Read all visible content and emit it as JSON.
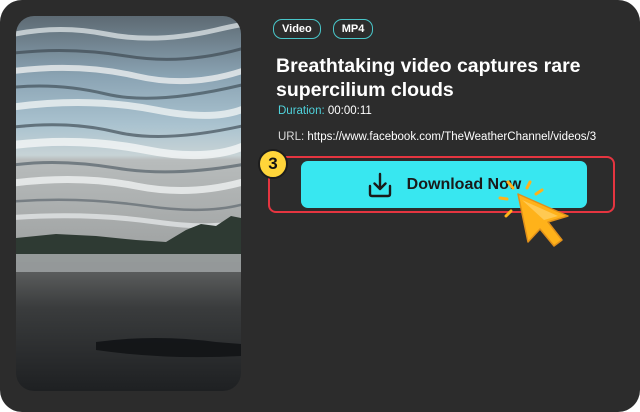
{
  "tags": [
    "Video",
    "MP4"
  ],
  "video": {
    "title": "Breathtaking video captures rare supercilium clouds",
    "duration_label": "Duration:",
    "duration_value": "00:00:11",
    "url_label": "URL:",
    "url_value": "https://www.facebook.com/TheWeatherChannel/videos/3"
  },
  "step_number": "3",
  "download_button": {
    "label": "Download Now",
    "icon": "download-icon"
  },
  "colors": {
    "card_bg": "#2c2c2c",
    "accent_cyan": "#38e7f0",
    "tag_border": "#49c6c9",
    "highlight_red": "#e53540",
    "badge_yellow": "#ffd53a",
    "cursor_orange": "#ffb21a"
  }
}
